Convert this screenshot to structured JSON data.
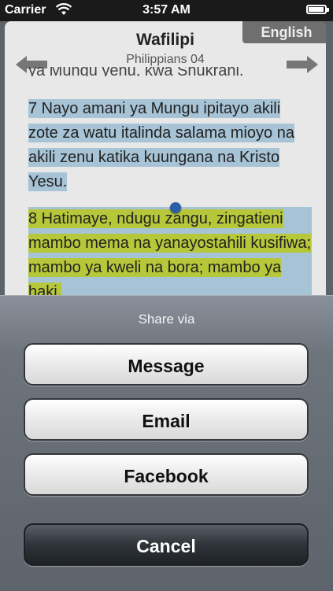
{
  "status_bar": {
    "carrier": "Carrier",
    "time": "3:57 AM",
    "battery_level": 0.9,
    "icons": [
      "wifi-icon",
      "battery-icon"
    ]
  },
  "reader": {
    "book_title": "Wafilipi",
    "chapter_subtitle": "Philippians 04",
    "language_button": "English",
    "clipped_line": "ya Mungu yenu, kwa Shukrani.",
    "verse7": "7 Nayo amani ya Mungu ipitayo akili zote za watu italinda salama mioyo na akili zenu katika kuungana na Kristo Yesu.",
    "verse8": "8 Hatimaye, ndugu zangu, zingatieni mambo mema na yanayostahili kusifiwa; mambo ya kweli na bora; mambo ya haki,"
  },
  "share_sheet": {
    "title": "Share via",
    "buttons": {
      "message": "Message",
      "email": "Email",
      "facebook": "Facebook",
      "cancel": "Cancel"
    }
  },
  "colors": {
    "highlight_blue": "#a7c3d6",
    "highlight_green": "#b7c73a",
    "selection_handle": "#2d5ca8"
  }
}
